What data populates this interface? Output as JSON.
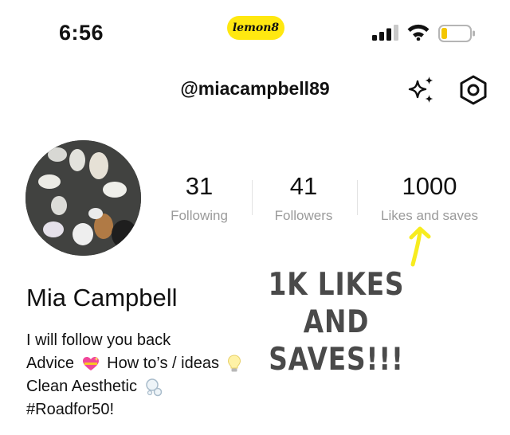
{
  "status_bar": {
    "time": "6:56",
    "app_logo": "lemon8",
    "icons": [
      "signal-bars-icon",
      "wifi-icon",
      "battery-low-icon"
    ],
    "accent": "#ffe810",
    "battery_color": "#f4c600"
  },
  "header": {
    "handle": "@miacampbell89",
    "icons": [
      "sparkle-icon",
      "settings-hexagon-icon"
    ]
  },
  "profile": {
    "name": "Mia Campbell",
    "bio": [
      "I will follow you back",
      "Advice",
      "How to’s / ideas",
      "Clean Aesthetic",
      "#Roadfor50!"
    ],
    "bio_emojis": [
      "sparkling-heart-emoji",
      "light-bulb-emoji",
      "bubbles-emoji"
    ]
  },
  "stats": {
    "following": {
      "value": "31",
      "label": "Following"
    },
    "followers": {
      "value": "41",
      "label": "Followers"
    },
    "likes": {
      "value": "1000",
      "label": "Likes and saves"
    }
  },
  "overlay": {
    "caption_line1": "1K LIKES AND",
    "caption_line2": "SAVES!!!",
    "arrow_color": "#f7ec1f",
    "caption_color": "#4a4a4a"
  }
}
